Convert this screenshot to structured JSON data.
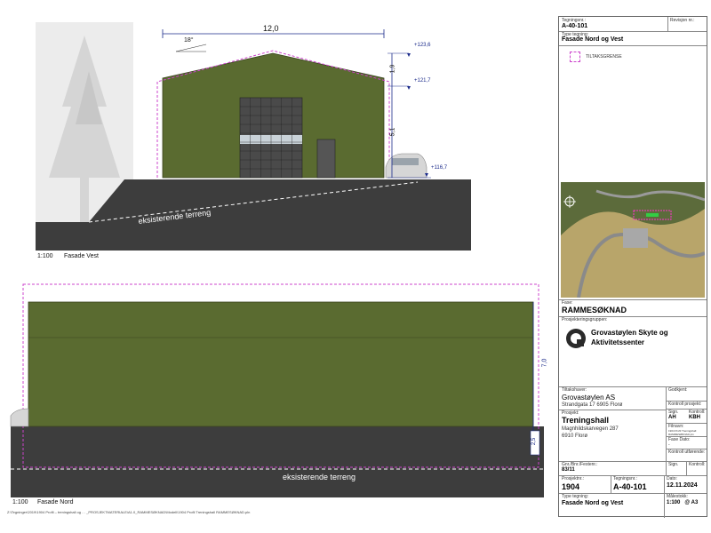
{
  "drawing": {
    "west_label_scale": "1:100",
    "west_label_name": "Fasade Vest",
    "north_label_scale": "1:100",
    "north_label_name": "Fasade Nord",
    "terrain_label_west": "eksisterende terreng",
    "terrain_label_north": "eksisterende terreng",
    "dim_width": "12,0",
    "dim_roof": "1,9",
    "dim_wall": "5,1",
    "dim_north_height": "7,0",
    "dim_north_lower": "2,5",
    "roof_angle": "18°",
    "elev_top": "+123,6",
    "elev_eave": "+121,7",
    "elev_ground": "+116,7",
    "file_path": "Z:\\Tegninger\\2019\\1904 Profil – treningshall og … _PROSJEKTMATERIALE\\A1.0_RAMMESØKNAD\\Modell\\1904 Profil Treningshall RAMMESØKNAD.pln",
    "colors": {
      "facade": "#5a6b30",
      "terrain": "#3d3d3d",
      "boundary": "#cc44cc"
    }
  },
  "titleblock": {
    "tegning_nr_label": "Tegningsnr.:",
    "tegning_nr": "A-40-101",
    "revisjon_label": "Revisjon nr.:",
    "type_label": "Type tegning:",
    "type_value": "Fasade Nord og Vest",
    "legend_item": "TILTAKSGRENSE",
    "fase_label": "Fase:",
    "fase_value": "RAMMESØKNAD",
    "prosj_gruppe_label": "Prosjekteringsgruppen:",
    "company_line1": "Grovastøylen Skyte og",
    "company_line2": "Aktivitetssenter",
    "tiltakshaver_label": "Tiltakshaver:",
    "tiltakshaver_name": "Grovastøylen AS",
    "tiltakshaver_addr": "Strandgata 17 6905  Florø",
    "godkjent_label": "Godkjent:",
    "kontroll_prosj_label": "Kontroll prosjekt:",
    "sign_label": "Sign.",
    "kontroll_label": "Kontroll:",
    "sign_value": "AH",
    "kontroll_value": "KBH",
    "filnavn_label": "Filnavn:",
    "filnavn_value": "1904 Profil Treningshall RAMMESØKNAD.pln",
    "fasedato_label": "Fase Dato:",
    "fasedato_value": "-",
    "kontroll_utf_label": "Kontroll utførende:",
    "prosjekt_label": "Prosjekt:",
    "prosjekt_name": "Treningshall",
    "prosjekt_addr1": "Magnhildskarvegen 287",
    "prosjekt_addr2": "6910 Florø",
    "gnr_label": "Gnr./Bnr./Festenr.:",
    "gnr_value": "83/11",
    "sign2_label": "Sign.",
    "kontroll2_label": "Kontroll:",
    "prosjnr_label": "Prosjektnr.:",
    "prosjnr_value": "1904",
    "tegnr2_label": "Tegningsnr.:",
    "tegnr2_value": "A-40-101",
    "dato_label": "Dato:",
    "dato_value": "12.11.2024",
    "type2_label": "Type tegning:",
    "type2_value": "Fasade Nord og Vest",
    "malestokk_label": "Målestokk:",
    "malestokk_value": "1:100   @ A3"
  }
}
